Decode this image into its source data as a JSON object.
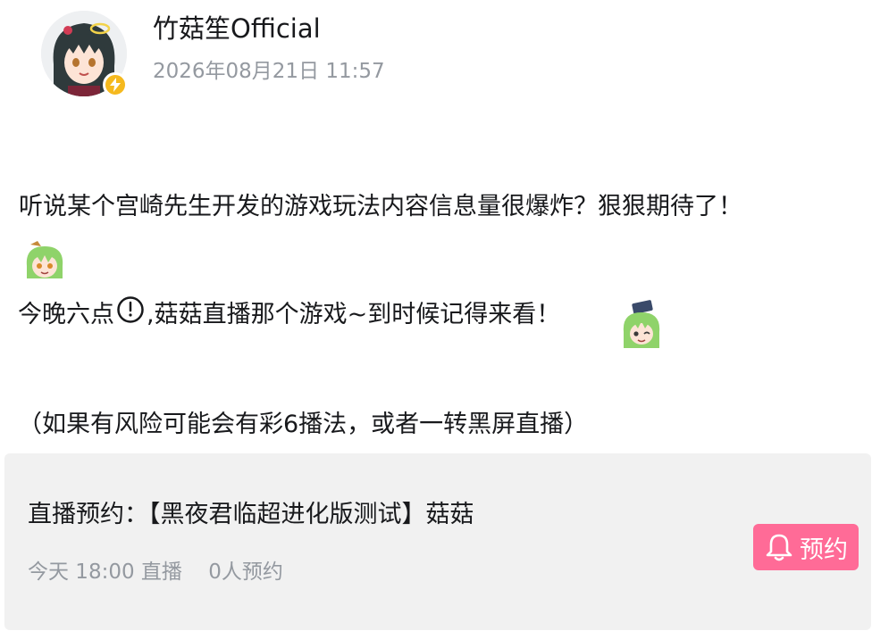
{
  "author": {
    "name": "竹菇笙Official",
    "time": "2026年08月21日 11:57"
  },
  "content": {
    "line1": "听说某个宫崎先生开发的游戏玩法内容信息量很爆炸？狠狠期待了！",
    "line2_part1": "今晚六点",
    "line2_part2": ",菇菇直播那个游戏~到时候记得来看！",
    "line3": "（如果有风险可能会有彩6播法，或者一转黑屏直播）"
  },
  "reservation": {
    "title": "直播预约：【黑夜君临超进化版测试】菇菇",
    "time": "今天 18:00 直播",
    "count": "0人预约",
    "button_label": "预约",
    "button_color": "#ff6b97"
  },
  "icons": [
    "avatar",
    "lightning-icon",
    "sticker-emoji",
    "clock-icon",
    "bell-icon"
  ]
}
